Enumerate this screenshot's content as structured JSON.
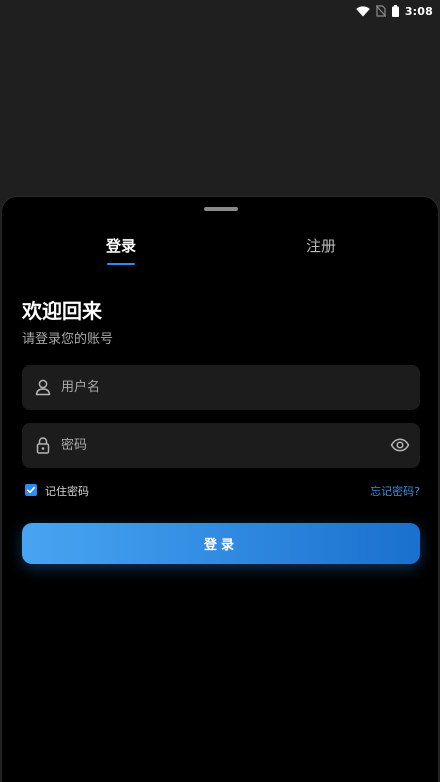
{
  "status_bar": {
    "time": "3:08",
    "icons": [
      "wifi-icon",
      "no-sim-icon",
      "battery-icon"
    ]
  },
  "tabs": {
    "login_label": "登录",
    "register_label": "注册",
    "active": "login"
  },
  "header": {
    "title": "欢迎回来",
    "subtitle": "请登录您的账号"
  },
  "form": {
    "username": {
      "placeholder": "用户名",
      "value": "",
      "icon": "user-icon"
    },
    "password": {
      "placeholder": "密码",
      "value": "",
      "icon": "lock-icon",
      "toggle_icon": "eye-icon"
    },
    "remember_label": "记住密码",
    "remember_checked": true,
    "forgot_label": "忘记密码?",
    "submit_label": "登录"
  },
  "colors": {
    "accent": "#2e8bf0",
    "background": "#000000",
    "field_background": "#1c1c1c"
  }
}
